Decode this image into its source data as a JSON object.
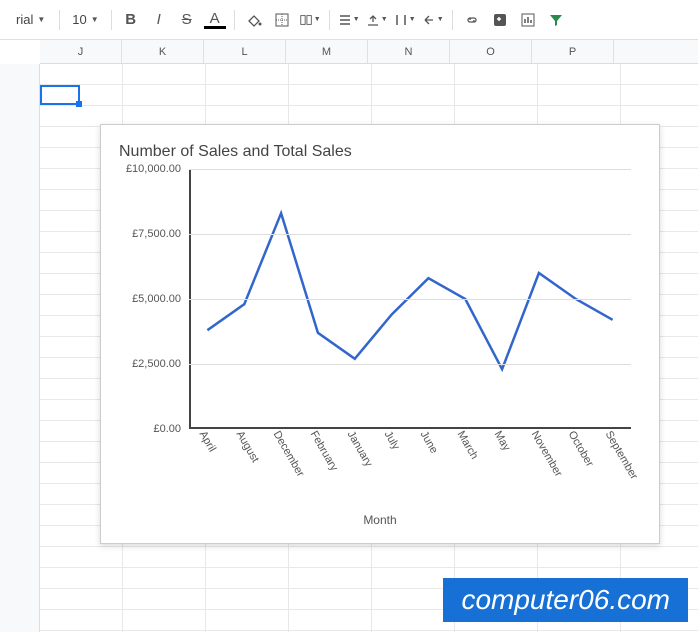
{
  "toolbar": {
    "font_name": "rial",
    "font_size": "10",
    "bold": "B",
    "italic": "I",
    "strike": "S",
    "text_color": "A"
  },
  "columns": [
    "J",
    "K",
    "L",
    "M",
    "N",
    "O",
    "P"
  ],
  "chart_data": {
    "type": "line",
    "title": "Number of Sales and Total Sales",
    "xlabel": "Month",
    "ylabel": "",
    "ylim": [
      0,
      10000
    ],
    "y_ticks": [
      0,
      2500,
      5000,
      7500,
      10000
    ],
    "y_tick_labels": [
      "£0.00",
      "£2,500.00",
      "£5,000.00",
      "£7,500.00",
      "£10,000.00"
    ],
    "categories": [
      "April",
      "August",
      "December",
      "February",
      "January",
      "July",
      "June",
      "March",
      "May",
      "November",
      "October",
      "September"
    ],
    "values": [
      3800,
      4800,
      8300,
      3700,
      2700,
      4400,
      5800,
      5000,
      2300,
      6000,
      5000,
      4200
    ],
    "line_color": "#3366cc"
  },
  "watermark": "computer06.com"
}
